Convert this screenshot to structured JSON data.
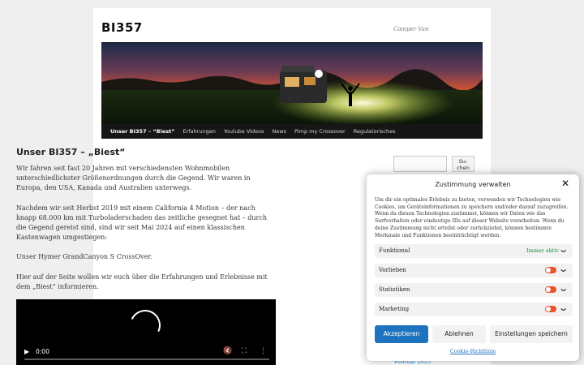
{
  "site": {
    "title": "BI357",
    "description": "Camper Van"
  },
  "nav": {
    "items": [
      {
        "label": "Unser BI357 – “Biest”",
        "active": true
      },
      {
        "label": "Erfahrungen"
      },
      {
        "label": "Youtube Videos"
      },
      {
        "label": "News"
      },
      {
        "label": "Pimp my Crossover"
      },
      {
        "label": "Regulatorisches"
      }
    ]
  },
  "article": {
    "title": "Unser BI357 – „Biest“",
    "paragraphs": [
      "Wir fahren seit fast 20 Jahren mit verschiedensten Wohnmobilen unterschiedlichster Größenordnungen durch die Gegend. Wir waren in Europa, den USA, Kanada und Australien unterwegs.",
      "Nachdem wir seit Herbst 2019 mit einem California 4 Motion – der nach knapp 68.000 km mit Turboladerschaden das zeitliche gesegnet hat – durch die Gegend gereist sind, sind wir seit Mai 2024 auf einen klassischen Kastenwagen umgestiegen:",
      "Unser Hymer GrandCanyon S CrossOver.",
      "Hier auf der Seite wollen wir euch über die Erfahrungen und Erlebnisse mit dem „Biest“ informieren."
    ]
  },
  "video": {
    "time": "0:00",
    "icons": {
      "play": "play-icon",
      "mute": "mute-icon",
      "fullscreen": "fullscreen-icon",
      "menu": "menu-icon"
    }
  },
  "search": {
    "placeholder": "",
    "button_label": "Su-\nchen"
  },
  "sidebar": {
    "archive_link": "Februar 2025"
  },
  "consent": {
    "title": "Zustimmung verwalten",
    "text": "Um dir ein optimales Erlebnis zu bieten, verwenden wir Technologien wie Cookies, um Geräteinformationen zu speichern und/oder darauf zuzugreifen. Wenn du diesen Technologien zustimmst, können wir Daten wie das Surfverhalten oder eindeutige IDs auf dieser Website verarbeiten. Wenn du deine Zustimmung nicht erteilst oder zurückziehst, können bestimmte Merkmale und Funktionen beeinträchtigt werden.",
    "categories": [
      {
        "label": "Funktional",
        "status": "Immer aktiv"
      },
      {
        "label": "Vorlieben"
      },
      {
        "label": "Statistiken"
      },
      {
        "label": "Marketing"
      }
    ],
    "accept_label": "Akzeptieren",
    "deny_label": "Ablehnen",
    "settings_label": "Einstellungen speichern",
    "policy_label": "Cookie-Richtlinie"
  },
  "colors": {
    "nav_bg": "#161616",
    "accept_bg": "#1e73be",
    "toggle_off": "#e8552d",
    "always_active": "#1e8a3a",
    "link": "#1b8be0"
  }
}
